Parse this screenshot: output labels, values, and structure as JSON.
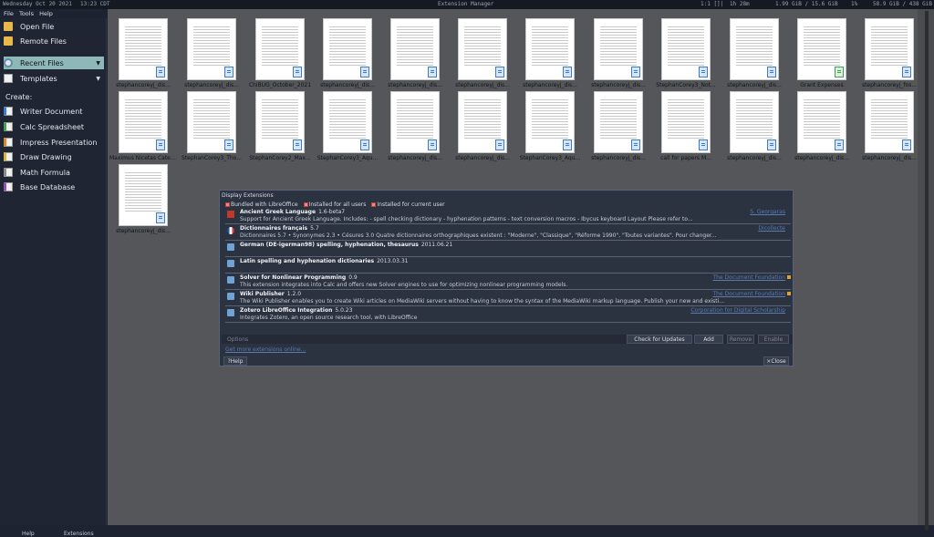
{
  "topbar": {
    "date": "Wednesday Oct 20 2021",
    "time": "13:23 CDT",
    "title": "Extension Manager",
    "layout": "1:1 []|",
    "uptime": "1h 28m",
    "memory": "1.99 GiB / 15.6 GiB",
    "cpu": "1%",
    "disk": "58.9 GiB / 438 GiB"
  },
  "menubar": {
    "file": "File",
    "tools": "Tools",
    "help": "Help"
  },
  "sidebar": {
    "open_file": "Open File",
    "remote_files": "Remote Files",
    "recent_files": "Recent Files",
    "templates": "Templates",
    "create_label": "Create:",
    "create": [
      "Writer Document",
      "Calc Spreadsheet",
      "Impress Presentation",
      "Draw Drawing",
      "Math Formula",
      "Base Database"
    ],
    "help": "Help",
    "extensions": "Extensions"
  },
  "recent_files": [
    "stephancoreyj_dis...",
    "stephancoreyj_dis...",
    "ChiBUG_October_2021",
    "stephancoreyj_dis...",
    "stephancoreyj_dis...",
    "stephancoreyj_dis...",
    "stephancoreyj_dis...",
    "stephancoreyj_dis...",
    "StephanCorey3_Not...",
    "stephancoreyj_dis...",
    "Grant Expenses",
    "stephancoreyj_fos...",
    "Maximus Nicetas Catena",
    "StephanCorey3_Tho...",
    "StephanCorey2_Max...",
    "StephanCorey3_Aqu...",
    "stephancoreyj_dis...",
    "stephancoreyj_dis...",
    "StephanCorey3_Aqu...",
    "stephancoreyj_dis...",
    "call for papers M...",
    "stephancoreyj_dis...",
    "stephancoreyj_dis...",
    "stephancoreyj_dis...",
    "stephancoreyj_dis..."
  ],
  "dialog": {
    "title": "Display Extensions",
    "filters": [
      "Bundled with LibreOffice",
      "Installed for all users",
      "Installed for current user"
    ],
    "extensions": [
      {
        "name": "Ancient Greek Language",
        "version": "1.6-beta7",
        "publisher": "S. Georgaras",
        "description": "Support for Ancient Greek Language. Includes:   - spell checking dictionary   - hyphenation patterns   - text conversion macros   - Ibycus keyboard Layout  Please refer to..."
      },
      {
        "name": "Dictionnaires français",
        "version": "5.7",
        "publisher": "Dicollecte",
        "description": "Dictionnaires 5.7 • Synonymes 2.3 • Césures 3.0    Quatre dictionnaires orthographiques existent : \"Moderne\", \"Classique\", \"Réforme 1990\", \"Toutes variantes\". Pour changer..."
      },
      {
        "name": "German (DE-igerman98) spelling, hyphenation, thesaurus",
        "version": "2011.06.21",
        "publisher": "",
        "description": ""
      },
      {
        "name": "Latin spelling and hyphenation dictionaries",
        "version": "2013.03.31",
        "publisher": "",
        "description": ""
      },
      {
        "name": "Solver for Nonlinear Programming",
        "version": "0.9",
        "publisher": "The Document Foundation",
        "description": "This extension integrates into Calc and offers new Solver engines to use for optimizing nonlinear programming models."
      },
      {
        "name": "Wiki Publisher",
        "version": "1.2.0",
        "publisher": "The Document Foundation",
        "description": "The Wiki Publisher enables you to create Wiki articles on MediaWiki servers without having to know the syntax of the MediaWiki markup language. Publish your new and existi..."
      },
      {
        "name": "Zotero LibreOffice Integration",
        "version": "5.0.23",
        "publisher": "Corporation for Digital Scholarship",
        "description": "Integrates Zotero, an open source research tool, with LibreOffice"
      }
    ],
    "options": "Options",
    "check_updates": "Check for Updates",
    "add": "Add",
    "remove": "Remove",
    "enable": "Enable",
    "get_more": "Get more extensions online...",
    "help": "Help",
    "close": "Close"
  }
}
